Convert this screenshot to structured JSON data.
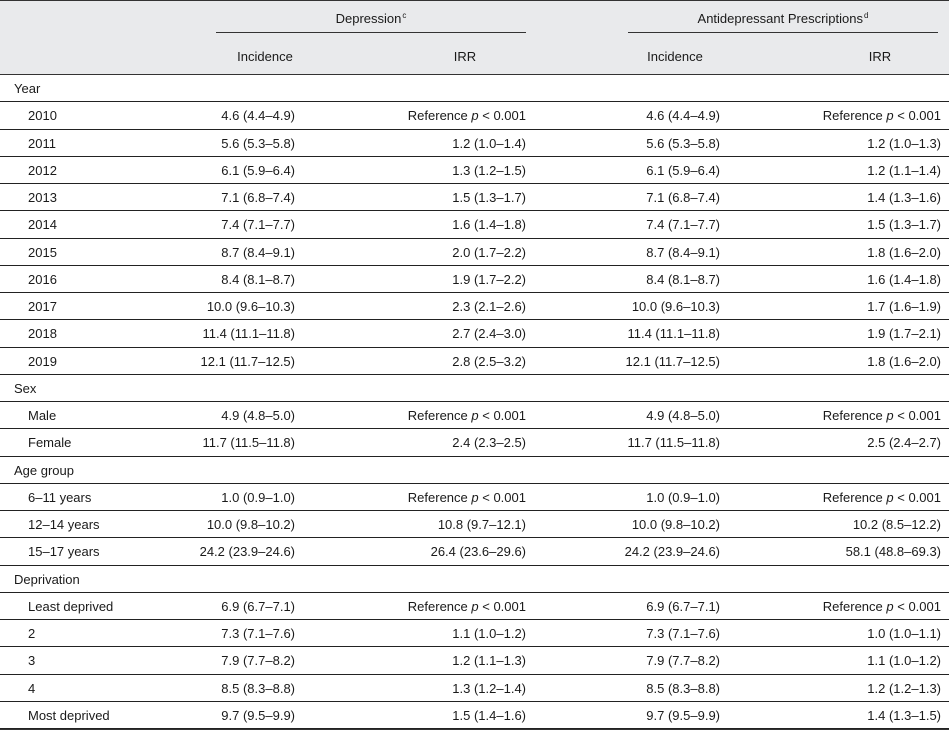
{
  "header": {
    "group1": "Depression",
    "group1_sup": "c",
    "group2": "Antidepressant Prescriptions",
    "group2_sup": "d",
    "col_incidence": "Incidence",
    "col_irr": "IRR"
  },
  "rows": [
    {
      "type": "section",
      "label": "Year"
    },
    {
      "type": "sub",
      "label": "2010",
      "d_inc": "4.6 (4.4–4.9)",
      "d_irr_ref": true,
      "a_inc": "4.6 (4.4–4.9)",
      "a_irr_ref": true
    },
    {
      "type": "sub",
      "label": "2011",
      "d_inc": "5.6 (5.3–5.8)",
      "d_irr": "1.2 (1.0–1.4)",
      "a_inc": "5.6 (5.3–5.8)",
      "a_irr": "1.2 (1.0–1.3)"
    },
    {
      "type": "sub",
      "label": "2012",
      "d_inc": "6.1 (5.9–6.4)",
      "d_irr": "1.3 (1.2–1.5)",
      "a_inc": "6.1 (5.9–6.4)",
      "a_irr": "1.2 (1.1–1.4)"
    },
    {
      "type": "sub",
      "label": "2013",
      "d_inc": "7.1 (6.8–7.4)",
      "d_irr": "1.5 (1.3–1.7)",
      "a_inc": "7.1 (6.8–7.4)",
      "a_irr": "1.4 (1.3–1.6)"
    },
    {
      "type": "sub",
      "label": "2014",
      "d_inc": "7.4 (7.1–7.7)",
      "d_irr": "1.6 (1.4–1.8)",
      "a_inc": "7.4 (7.1–7.7)",
      "a_irr": "1.5 (1.3–1.7)"
    },
    {
      "type": "sub",
      "label": "2015",
      "d_inc": "8.7 (8.4–9.1)",
      "d_irr": "2.0 (1.7–2.2)",
      "a_inc": "8.7 (8.4–9.1)",
      "a_irr": "1.8 (1.6–2.0)"
    },
    {
      "type": "sub",
      "label": "2016",
      "d_inc": "8.4 (8.1–8.7)",
      "d_irr": "1.9 (1.7–2.2)",
      "a_inc": "8.4 (8.1–8.7)",
      "a_irr": "1.6 (1.4–1.8)"
    },
    {
      "type": "sub",
      "label": "2017",
      "d_inc": "10.0 (9.6–10.3)",
      "d_irr": "2.3 (2.1–2.6)",
      "a_inc": "10.0 (9.6–10.3)",
      "a_irr": "1.7 (1.6–1.9)"
    },
    {
      "type": "sub",
      "label": "2018",
      "d_inc": "11.4 (11.1–11.8)",
      "d_irr": "2.7 (2.4–3.0)",
      "a_inc": "11.4 (11.1–11.8)",
      "a_irr": "1.9 (1.7–2.1)"
    },
    {
      "type": "sub",
      "label": "2019",
      "d_inc": "12.1 (11.7–12.5)",
      "d_irr": "2.8 (2.5–3.2)",
      "a_inc": "12.1 (11.7–12.5)",
      "a_irr": "1.8 (1.6–2.0)"
    },
    {
      "type": "section",
      "label": "Sex"
    },
    {
      "type": "sub",
      "label": "Male",
      "d_inc": "4.9 (4.8–5.0)",
      "d_irr_ref": true,
      "a_inc": "4.9 (4.8–5.0)",
      "a_irr_ref": true
    },
    {
      "type": "sub",
      "label": "Female",
      "d_inc": "11.7 (11.5–11.8)",
      "d_irr": "2.4 (2.3–2.5)",
      "a_inc": "11.7 (11.5–11.8)",
      "a_irr": "2.5 (2.4–2.7)"
    },
    {
      "type": "section",
      "label": "Age group"
    },
    {
      "type": "sub",
      "label": "6–11 years",
      "d_inc": "1.0 (0.9–1.0)",
      "d_irr_ref": true,
      "a_inc": "1.0 (0.9–1.0)",
      "a_irr_ref": true
    },
    {
      "type": "sub",
      "label": "12–14 years",
      "d_inc": "10.0 (9.8–10.2)",
      "d_irr": "10.8 (9.7–12.1)",
      "a_inc": "10.0 (9.8–10.2)",
      "a_irr": "10.2 (8.5–12.2)"
    },
    {
      "type": "sub",
      "label": "15–17 years",
      "d_inc": "24.2 (23.9–24.6)",
      "d_irr": "26.4 (23.6–29.6)",
      "a_inc": "24.2 (23.9–24.6)",
      "a_irr": "58.1 (48.8–69.3)"
    },
    {
      "type": "section",
      "label": "Deprivation"
    },
    {
      "type": "sub",
      "label": "Least deprived",
      "d_inc": "6.9 (6.7–7.1)",
      "d_irr_ref": true,
      "a_inc": "6.9 (6.7–7.1)",
      "a_irr_ref": true
    },
    {
      "type": "sub",
      "label": "2",
      "d_inc": "7.3 (7.1–7.6)",
      "d_irr": "1.1 (1.0–1.2)",
      "a_inc": "7.3 (7.1–7.6)",
      "a_irr": "1.0 (1.0–1.1)"
    },
    {
      "type": "sub",
      "label": "3",
      "d_inc": "7.9 (7.7–8.2)",
      "d_irr": "1.2 (1.1–1.3)",
      "a_inc": "7.9 (7.7–8.2)",
      "a_irr": "1.1 (1.0–1.2)"
    },
    {
      "type": "sub",
      "label": "4",
      "d_inc": "8.5 (8.3–8.8)",
      "d_irr": "1.3 (1.2–1.4)",
      "a_inc": "8.5 (8.3–8.8)",
      "a_irr": "1.2 (1.2–1.3)"
    },
    {
      "type": "sub",
      "label": "Most deprived",
      "d_inc": "9.7 (9.5–9.9)",
      "d_irr": "1.5 (1.4–1.6)",
      "a_inc": "9.7 (9.5–9.9)",
      "a_irr": "1.4 (1.3–1.5)"
    }
  ],
  "reference": {
    "word": "Reference",
    "p_symbol": "p",
    "p_value": "< 0.001"
  }
}
